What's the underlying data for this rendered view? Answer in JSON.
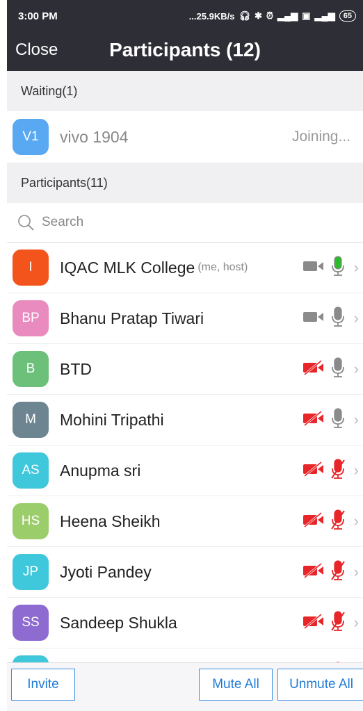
{
  "status_bar": {
    "time": "3:00 PM",
    "speed": "...25.9KB/s",
    "battery": "65"
  },
  "header": {
    "close_label": "Close",
    "title": "Participants (12)"
  },
  "waiting": {
    "heading": "Waiting(1)",
    "items": [
      {
        "initials": "V1",
        "name": "vivo 1904",
        "status": "Joining...",
        "color": "#58a9f2"
      }
    ]
  },
  "participants": {
    "heading": "Participants(11)",
    "search_placeholder": "Search",
    "items": [
      {
        "initials": "I",
        "name": "IQAC MLK College",
        "tag": "(me, host)",
        "color": "#f2541b",
        "video": "on",
        "audio": "active"
      },
      {
        "initials": "BP",
        "name": "Bhanu Pratap Tiwari",
        "tag": "",
        "color": "#e98bbf",
        "video": "on",
        "audio": "on"
      },
      {
        "initials": "B",
        "name": "BTD",
        "tag": "",
        "color": "#6cc07a",
        "video": "off",
        "audio": "on"
      },
      {
        "initials": "M",
        "name": "Mohini Tripathi",
        "tag": "",
        "color": "#6d8590",
        "video": "off",
        "audio": "on"
      },
      {
        "initials": "AS",
        "name": "Anupma sri",
        "tag": "",
        "color": "#3fc7dc",
        "video": "off",
        "audio": "off"
      },
      {
        "initials": "HS",
        "name": "Heena Sheikh",
        "tag": "",
        "color": "#9ccd6b",
        "video": "off",
        "audio": "off"
      },
      {
        "initials": "JP",
        "name": "Jyoti Pandey",
        "tag": "",
        "color": "#3fc7dc",
        "video": "off",
        "audio": "off"
      },
      {
        "initials": "SS",
        "name": "Sandeep Shukla",
        "tag": "",
        "color": "#8e6bd0",
        "video": "off",
        "audio": "off"
      },
      {
        "initials": "",
        "name": "",
        "tag": "",
        "color": "#3fc7dc",
        "video": "off",
        "audio": "off"
      }
    ]
  },
  "footer": {
    "invite_label": "Invite",
    "mute_all_label": "Mute All",
    "unmute_all_label": "Unmute All"
  },
  "colors": {
    "header_bg": "#2e2e36",
    "accent": "#1f7ad6",
    "muted_red": "#e8262a",
    "active_green": "#2dba2d",
    "icon_gray": "#8a8a8a"
  }
}
